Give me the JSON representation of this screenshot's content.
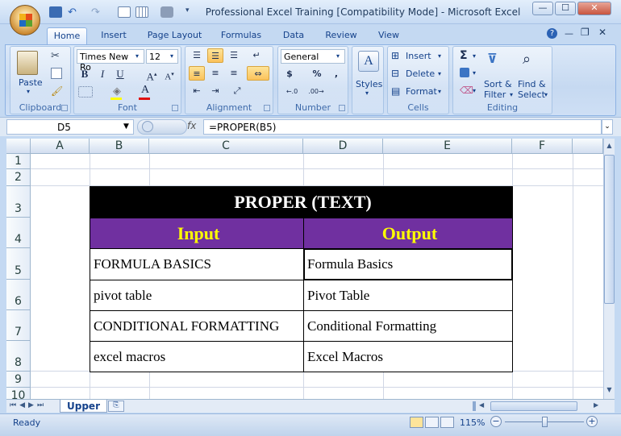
{
  "window": {
    "title": "Professional Excel Training  [Compatibility Mode] - Microsoft Excel",
    "minimize": "—",
    "maximize": "☐",
    "close": "✕"
  },
  "ribbon_tabs": [
    "Home",
    "Insert",
    "Page Layout",
    "Formulas",
    "Data",
    "Review",
    "View"
  ],
  "ribbon": {
    "clipboard": {
      "label": "Clipboard",
      "paste": "Paste"
    },
    "font": {
      "label": "Font",
      "font_name": "Times New Ro",
      "font_size": "12",
      "bold": "B",
      "italic": "I",
      "underline": "U"
    },
    "alignment": {
      "label": "Alignment"
    },
    "number": {
      "label": "Number",
      "format": "General",
      "currency": "$",
      "percent": "%",
      "comma": ","
    },
    "styles": {
      "label": "Styles"
    },
    "cells": {
      "label": "Cells",
      "insert": "Insert",
      "delete": "Delete",
      "format": "Format"
    },
    "editing": {
      "label": "Editing",
      "sort": "Sort &",
      "filter": "Filter",
      "find": "Find &",
      "select": "Select"
    }
  },
  "formula_bar": {
    "name_box": "D5",
    "fx": "fx",
    "formula": "=PROPER(B5)"
  },
  "grid": {
    "columns": [
      "A",
      "B",
      "C",
      "D",
      "E",
      "F"
    ],
    "rows": [
      "1",
      "2",
      "3",
      "4",
      "5",
      "6",
      "7",
      "8",
      "9",
      "10"
    ]
  },
  "table": {
    "title": "PROPER (TEXT)",
    "input_header": "Input",
    "output_header": "Output",
    "rows": [
      {
        "input": "FORMULA BASICS",
        "output": "Formula Basics"
      },
      {
        "input": "pivot table",
        "output": "Pivot Table"
      },
      {
        "input": "CONDITIONAL FORMATTING",
        "output": "Conditional Formatting"
      },
      {
        "input": "excel macros",
        "output": "Excel Macros"
      }
    ],
    "title_bg": "#000000",
    "header_bg": "#7030a0",
    "header_fg": "#ffff00"
  },
  "sheet_tabs": [
    "Upper"
  ],
  "status": {
    "text": "Ready",
    "zoom": "115%"
  }
}
